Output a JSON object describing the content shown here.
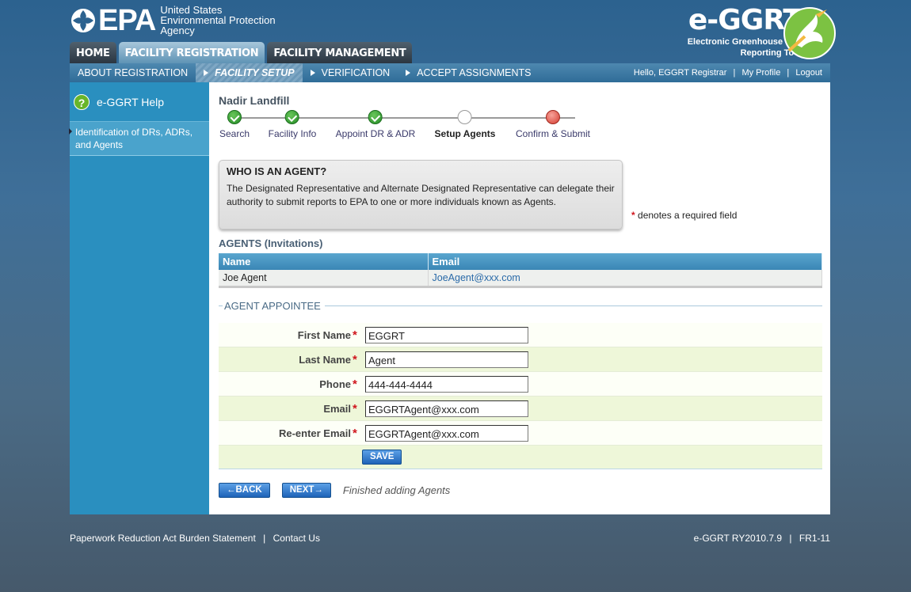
{
  "brand": {
    "epa_mark": "EPA",
    "epa_line1": "United States",
    "epa_line2": "Environmental Protection",
    "epa_line3": "Agency",
    "app_title": "e-GGRT",
    "app_sub1": "Electronic Greenhouse Gas",
    "app_sub2": "Reporting Tool"
  },
  "main_tabs": [
    {
      "label": "HOME",
      "active": false
    },
    {
      "label": "FACILITY REGISTRATION",
      "active": true
    },
    {
      "label": "FACILITY MANAGEMENT",
      "active": false
    }
  ],
  "subnav": {
    "items": [
      {
        "label": "ABOUT REGISTRATION"
      },
      {
        "label": "FACILITY SETUP"
      },
      {
        "label": "VERIFICATION"
      },
      {
        "label": "ACCEPT ASSIGNMENTS"
      }
    ],
    "user_greeting": "Hello, EGGRT Registrar",
    "my_profile": "My Profile",
    "logout": "Logout"
  },
  "sidebar": {
    "help_label": "e-GGRT Help",
    "help_icon": "?",
    "items": [
      {
        "label": "Identification of DRs, ADRs, and Agents"
      }
    ]
  },
  "page": {
    "facility_name": "Nadir Landfill",
    "steps": [
      {
        "label": "Search",
        "state": "done"
      },
      {
        "label": "Facility Info",
        "state": "done"
      },
      {
        "label": "Appoint DR & ADR",
        "state": "done"
      },
      {
        "label": "Setup Agents",
        "state": "current"
      },
      {
        "label": "Confirm & Submit",
        "state": "todo"
      }
    ],
    "info_box": {
      "title": "WHO IS AN AGENT?",
      "text": "The Designated Representative and Alternate Designated Representative can delegate their authority to submit reports to EPA to one or more individuals known as Agents."
    },
    "required_note": "denotes a required field",
    "agents_title": "AGENTS (Invitations)",
    "agents_table": {
      "columns": [
        "Name",
        "Email"
      ],
      "rows": [
        {
          "name": "Joe Agent",
          "email": "JoeAgent@xxx.com"
        }
      ]
    },
    "appointee": {
      "legend": "AGENT APPOINTEE",
      "fields": {
        "first_name": {
          "label": "First Name",
          "value": "EGGRT"
        },
        "last_name": {
          "label": "Last Name",
          "value": "Agent"
        },
        "phone": {
          "label": "Phone",
          "value": "444-444-4444"
        },
        "email": {
          "label": "Email",
          "value": "EGGRTAgent@xxx.com"
        },
        "reenter_email": {
          "label": "Re-enter Email",
          "value": "EGGRTAgent@xxx.com"
        }
      },
      "save_label": "SAVE"
    },
    "back_label": "BACK",
    "next_label": "NEXT",
    "finished_note": "Finished adding Agents"
  },
  "footer": {
    "paperwork": "Paperwork Reduction Act Burden Statement",
    "contact": "Contact Us",
    "version": "e-GGRT RY2010.7.9",
    "build": "FR1-11"
  },
  "colors": {
    "sidebar": "#2a8fbf",
    "table_header": "#3a86b5",
    "button": "#1e63b8",
    "required_star": "#d0161e"
  }
}
